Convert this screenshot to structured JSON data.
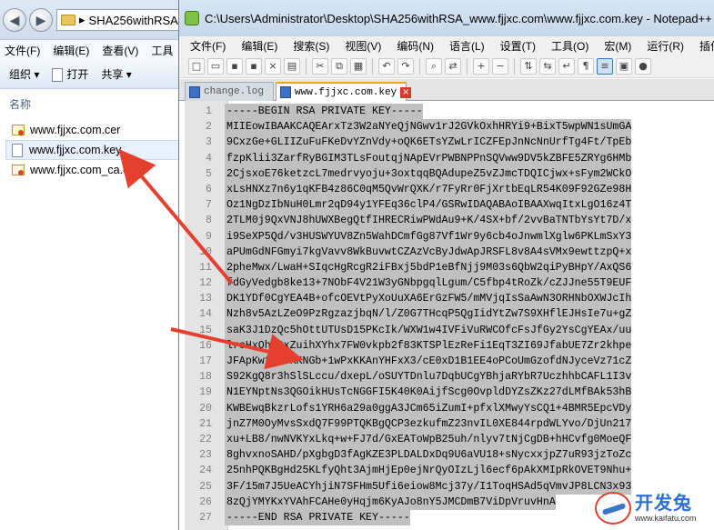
{
  "explorer": {
    "address": "SHA256withRSA",
    "menu": [
      "文件(F)",
      "编辑(E)",
      "查看(V)",
      "工具"
    ],
    "toolbar": {
      "organize": "组织 ▾",
      "open": "打开",
      "share": "共享 ▾"
    },
    "column_header": "名称",
    "files": [
      {
        "name": "www.fjjxc.com.cer",
        "icon": "certificate-icon",
        "selected": false
      },
      {
        "name": "www.fjjxc.com.key",
        "icon": "key-file-icon",
        "selected": true
      },
      {
        "name": "www.fjjxc.com_ca.cer",
        "icon": "certificate-icon",
        "selected": false
      }
    ]
  },
  "notepad": {
    "title": "C:\\Users\\Administrator\\Desktop\\SHA256withRSA_www.fjjxc.com\\www.fjjxc.com.key - Notepad++",
    "menu": [
      "文件(F)",
      "编辑(E)",
      "搜索(S)",
      "视图(V)",
      "编码(N)",
      "语言(L)",
      "设置(T)",
      "工具(O)",
      "宏(M)",
      "运行(R)",
      "插件(P)"
    ],
    "tabs": [
      {
        "label": "change.log",
        "active": false
      },
      {
        "label": "www.fjjxc.com.key",
        "active": true
      }
    ],
    "lines": [
      "-----BEGIN RSA PRIVATE KEY-----",
      "MIIEowIBAAKCAQEArxTz3W2aNYeQjNGwv1rJ2GVkOxhHRYi9+BixT5wpWN1sUmGA",
      "9CxzGe+GLIIZuFuFKeDvYZnVdy+oQK6ETsYZwLrICZFEpJnNcNnUrfTg4Ft/TpEb",
      "fzpKlii3ZarfRyBGIM3TLsFoutqjNApEVrPWBNPPnSQVww9DV5kZBFE5ZRYg6HMb",
      "2CjsxoE76ketzcL7medrvyoju+3oxtqqBQAdupeZ5vZJmcTDQICjwx+sFym2WCkO",
      "xLsHNXz7n6y1qKFB4z86C0qM5QvWrQXK/r7FyRr0FjXrtbEqLR54K09F92GZe98H",
      "Oz1NgDzIbNuH0Lmr2qD94y1YFEq36clP4/GSRwIDAQABAoIBAAXwqItxLgO16z4T",
      "2TLM0j9QxVNJ8hUWXBegQtfIHRECRiwPWdAu9+K/4SX+bf/2vvBaTNTbYsYt7D/x",
      "i9SeXP5Qd/v3HUSWYUV8Zn5WahDCmfGg87Vf1Wr9y6cb4oJnwmlXglw6PKLmSxY3",
      "aPUmGdNFGmyi7kgVavv8WkBuvwtCZAzVcByJdwApJRSFL8v8A4sVMx9ewttzpQ+x",
      "2pheMwx/LwaH+SIqcHgRcgR2iFBxj5bdP1eBfNjj9M03s6QbW2qiPyBHpY/AxQS6",
      "fdGyVedgb8ke13+7NObF4V21W3yGNbpgqlLgum/C5fbp4tRoZk/cZJJne55T9EUF",
      "DK1YDf0CgYEA4B+ofcOEVtPyXoUuXA6ErGzFW5/mMVjqIsSaAwN3ORHNbOXWJcIh",
      "Nzh8v5AzLZeO9PzRgzazjbqN/l/Z0G7THcqP5QgIidYtZw7S9XHflEJHsIe7u+gZ",
      "saK3J1DzQc5hOttUTUsD15PKcIk/WXW1w4IVFiVuRWCOfcFsJfGy2YsCgYEAx/uu",
      "lrcHxOhaGxZuihXYhx7FW0vkpb2f83KTSPlEzReFi1EqT3ZI69JfabUE7Zr2khpe",
      "JFApKwfSh3KKNGb+1wPxKKAnYHFxX3/cE0xD1B1EE4oPCoUmGzofdNJyceVz71cZ",
      "S92KgQ8r3hSlSLccu/dxepL/oSUYTDnlu7DqbUCgYBhjaRYbR7UczhhbCAFL1I3v",
      "N1EYNptNs3QGOikHUsTcNGGFI5K40K0AijfScg0OvpldDYZsZKz27dLMfBAk53hB",
      "KWBEwqBkzrLofs1YRH6a29a0ggA3JCm65iZumI+pfxlXMwyYsCQ1+4BMR5EpcVDy",
      "jnZ7M0OyMvsSxdQ7F99PTQKBgQCP3ezkufmZ23nvIL0XE844rpdWLYvo/DjUn217",
      "xu+LB8/nwNVKYxLkq+w+FJ7d/GxEAToWpB25uh/nlyv7tNjCgDB+hHCvfg0MoeQF",
      "8ghvxnoSAHD/pXgbgD3fAgKZE3PLDALDxDq9U6aVU18+sNycxxjpZ7uR93jzToZc",
      "25nhPQKBgHd25KLfyQht3AjmHjEp0ejNrQyOIzLjl6ecf6pAkXMIpRkOVET9Nhu+",
      "3F/15m7J5UeACYhjiN7SFHm5Ufi6eiow8Mcj37y/I1ToqHSAd5qVmvJP8LCN3x93",
      "8zQjYMYKxYVAhFCAHe0yHqjm6KyAJo8nY5JMCDmB7ViDpVruvHnA",
      "-----END RSA PRIVATE KEY-----"
    ]
  },
  "watermark": {
    "name": "开发兔",
    "url": "www.kaifatu.com"
  },
  "colors": {
    "arrow": "#e5402f",
    "selection": "#c0c0c0",
    "gutter": "#e4e4e4",
    "active_tab_accent": "#f7a01c"
  }
}
